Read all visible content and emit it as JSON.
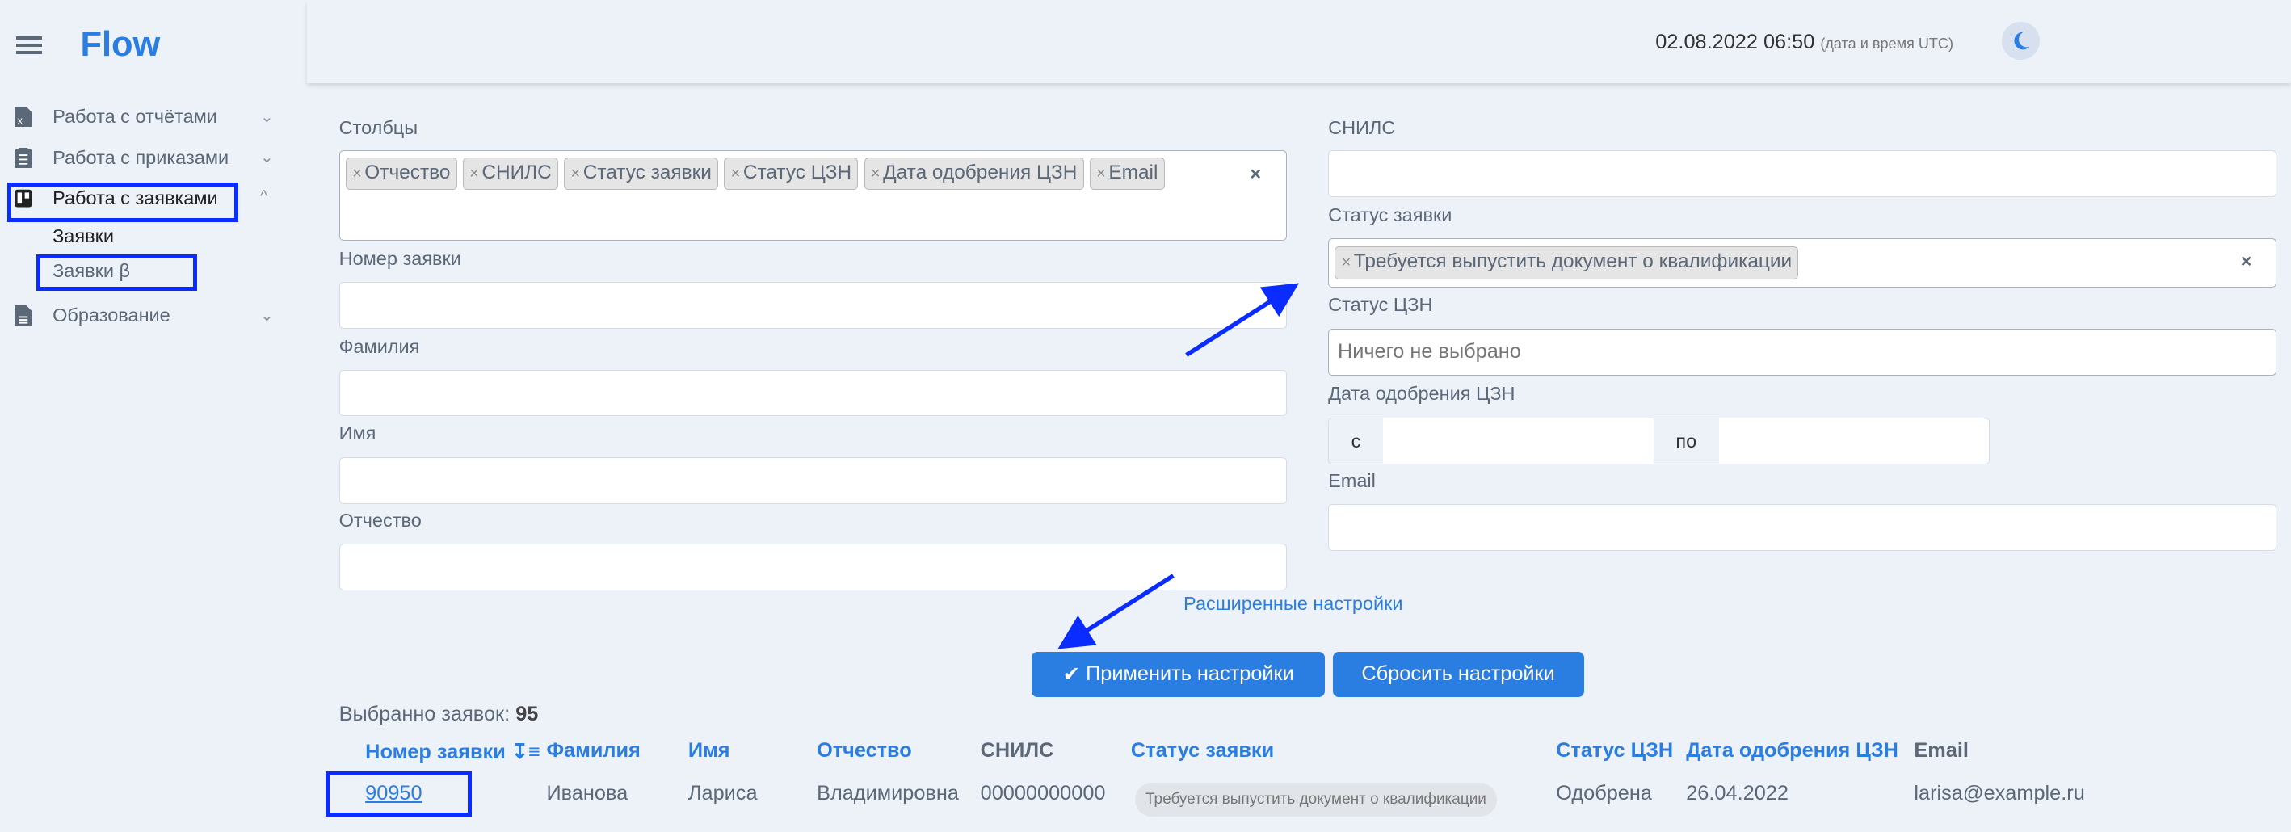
{
  "app": {
    "logo": "Flow"
  },
  "header": {
    "datetime": "02.08.2022 06:50",
    "datetime_note": "(дата и время UTC)",
    "theme_icon": "moon-icon"
  },
  "sidebar": {
    "items": [
      {
        "label": "Работа с отчётами",
        "icon": "file-excel-icon"
      },
      {
        "label": "Работа с приказами",
        "icon": "clipboard-list-icon"
      },
      {
        "label": "Работа с заявками",
        "icon": "trello-board-icon"
      },
      {
        "label": "Образование",
        "icon": "file-text-icon"
      }
    ],
    "subitems": [
      {
        "label": "Заявки"
      },
      {
        "label": "Заявки β"
      }
    ]
  },
  "filters": {
    "columns_label": "Столбцы",
    "columns_tags": [
      "Отчество",
      "СНИЛС",
      "Статус заявки",
      "Статус ЦЗН",
      "Дата одобрения ЦЗН",
      "Email"
    ],
    "number_label": "Номер заявки",
    "lastname_label": "Фамилия",
    "firstname_label": "Имя",
    "patronymic_label": "Отчество",
    "snils_label": "СНИЛС",
    "status_label": "Статус заявки",
    "status_tags": [
      "Требуется выпустить документ о квалификации"
    ],
    "czn_status_label": "Статус ЦЗН",
    "czn_status_placeholder": "Ничего не выбрано",
    "czn_date_label": "Дата одобрения ЦЗН",
    "date_from": "с",
    "date_to": "по",
    "email_label": "Email",
    "clear_symbol": "×",
    "tag_remove_symbol": "×",
    "advanced_link": "Расширенные настройки",
    "apply_button": "Применить настройки",
    "reset_button": "Сбросить настройки"
  },
  "results": {
    "count_label": "Выбранно заявок:",
    "count": "95",
    "columns": [
      "Номер заявки",
      "Фамилия",
      "Имя",
      "Отчество",
      "СНИЛС",
      "Статус заявки",
      "Статус ЦЗН",
      "Дата одобрения ЦЗН",
      "Email"
    ],
    "rows": [
      {
        "number": "90950",
        "lastname": "Иванова",
        "firstname": "Лариса",
        "patronymic": "Владимировна",
        "snils": "00000000000",
        "status": "Требуется выпустить документ о квалификации",
        "czn_status": "Одобрена",
        "czn_date": "26.04.2022",
        "email": "larisa@example.ru"
      }
    ]
  },
  "colors": {
    "accent": "#2a7de1",
    "background": "#edf1f8",
    "annotation": "#0a2cff"
  }
}
